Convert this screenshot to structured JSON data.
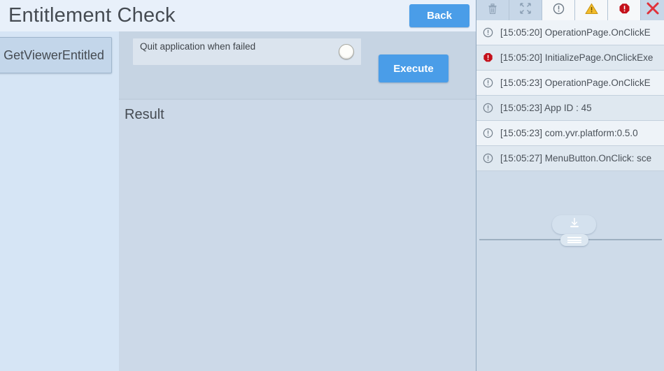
{
  "header": {
    "title": "Entitlement Check",
    "back_label": "Back",
    "accent_color": "#4a9de8"
  },
  "sidebar": {
    "items": [
      {
        "label": "GetViewerEntitled",
        "icon": "list-item-icon",
        "selected": true
      }
    ]
  },
  "main": {
    "options": [
      {
        "label": "Quit application when failed",
        "control": "toggle-knob",
        "value": "off"
      }
    ],
    "execute_label": "Execute",
    "result_title": "Result",
    "result_body": ""
  },
  "log_panel": {
    "toolbar": [
      {
        "name": "clear-log-button",
        "icon": "trash-icon",
        "state": "inactive"
      },
      {
        "name": "collapse-button",
        "icon": "collapse-icon",
        "state": "inactive"
      },
      {
        "name": "filter-info-button",
        "icon": "info-icon",
        "state": "active"
      },
      {
        "name": "filter-warning-button",
        "icon": "warning-icon",
        "state": "active"
      },
      {
        "name": "filter-error-button",
        "icon": "error-icon",
        "state": "active"
      },
      {
        "name": "close-log-button",
        "icon": "close-icon",
        "state": "inactive"
      }
    ],
    "entries": [
      {
        "level": "info",
        "time": "[15:05:20]",
        "message": "OperationPage.OnClickE"
      },
      {
        "level": "error",
        "time": "[15:05:20]",
        "message": "InitializePage.OnClickExe"
      },
      {
        "level": "info",
        "time": "[15:05:23]",
        "message": "OperationPage.OnClickE"
      },
      {
        "level": "info",
        "time": "[15:05:23]",
        "message": "App ID : 45"
      },
      {
        "level": "info",
        "time": "[15:05:23]",
        "message": "com.yvr.platform:0.5.0"
      },
      {
        "level": "info",
        "time": "[15:05:27]",
        "message": "MenuButton.OnClick: sce"
      }
    ],
    "download_icon": "download-icon",
    "splitter_icon": "drag-handle-icon"
  },
  "colors": {
    "accent_blue": "#4a9de8",
    "error_red": "#c4101a",
    "warning_amber": "#f0b323",
    "close_red": "#e0313a",
    "sidebar_bg": "#d6e5f5",
    "main_bg": "#ccd9e8",
    "header_bg": "#e8f0fa",
    "log_bg": "#cedbe9"
  }
}
